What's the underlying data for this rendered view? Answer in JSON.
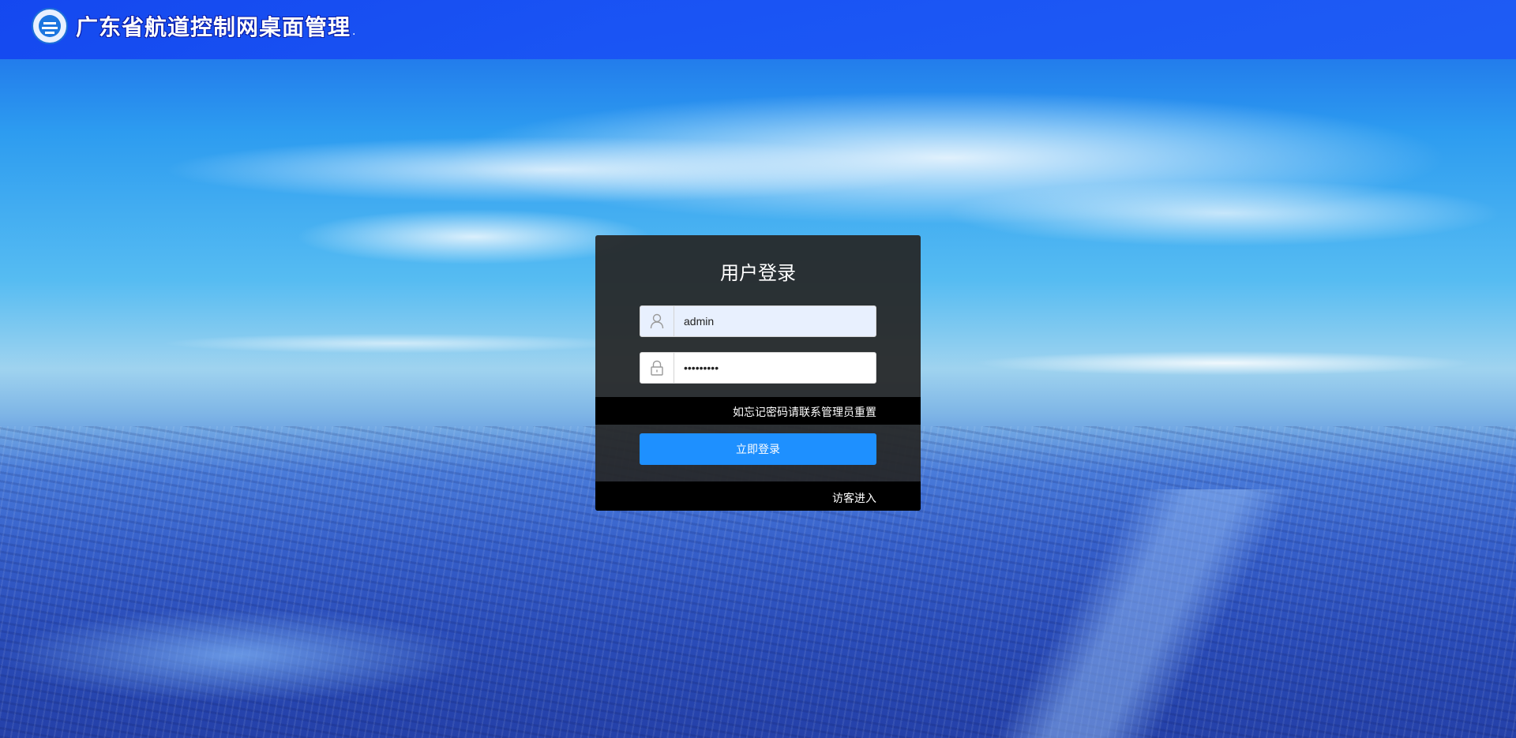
{
  "header": {
    "logo_icon": "navigation-bureau-emblem-icon",
    "title": "广东省航道控制网桌面管理",
    "title_suffix": "."
  },
  "login": {
    "title": "用户登录",
    "username": {
      "icon": "user-icon",
      "value": "admin"
    },
    "password": {
      "icon": "lock-icon",
      "value": "•••••••••"
    },
    "forgot_text": "如忘记密码请联系管理员重置",
    "submit_label": "立即登录",
    "guest_label": "访客进入"
  },
  "colors": {
    "header_bg": "#1a4ef0",
    "panel_bg": "#262626",
    "button_bg": "#1e90ff",
    "strip_bg": "#000000"
  }
}
